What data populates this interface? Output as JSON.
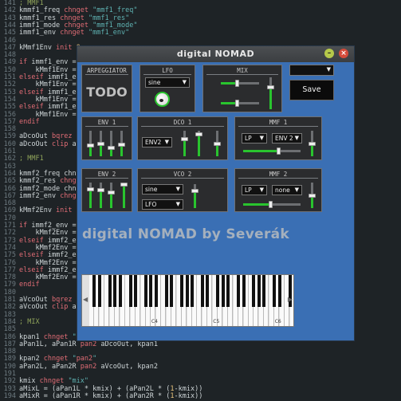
{
  "editor": {
    "lines": [
      {
        "n": "141",
        "code": "; MMF1"
      },
      {
        "n": "142",
        "code": "kmmf1_freq chnget \"mmf1_freq\""
      },
      {
        "n": "143",
        "code": "kmmf1_res chnget \"mmf1_res\""
      },
      {
        "n": "144",
        "code": "immf1_mode chnget \"mmf1_mode\""
      },
      {
        "n": "145",
        "code": "immf1_env chnget \"mmf1_env\""
      },
      {
        "n": "146",
        "code": ""
      },
      {
        "n": "147",
        "code": "kMmf1Env init 0"
      },
      {
        "n": "148",
        "code": ""
      },
      {
        "n": "149",
        "code": "if immf1_env =="
      },
      {
        "n": "150",
        "code": "    kMmf1Env ="
      },
      {
        "n": "151",
        "code": "elseif immf1_env"
      },
      {
        "n": "152",
        "code": "    kMmf1Env ="
      },
      {
        "n": "153",
        "code": "elseif immf1_env"
      },
      {
        "n": "154",
        "code": "    kMmf1Env ="
      },
      {
        "n": "155",
        "code": "elseif immf1_env"
      },
      {
        "n": "156",
        "code": "    kMmf1Env ="
      },
      {
        "n": "157",
        "code": "endif"
      },
      {
        "n": "158",
        "code": ""
      },
      {
        "n": "159",
        "code": "aDcoOut bqrez a"
      },
      {
        "n": "160",
        "code": "aDcoOut clip aD"
      },
      {
        "n": "161",
        "code": ""
      },
      {
        "n": "162",
        "code": "; MMF1"
      },
      {
        "n": "163",
        "code": ""
      },
      {
        "n": "164",
        "code": "kmmf2_freq chnge"
      },
      {
        "n": "165",
        "code": "kmmf2_res chnget"
      },
      {
        "n": "166",
        "code": "immf2_mode chng"
      },
      {
        "n": "167",
        "code": "immf2_env chnget"
      },
      {
        "n": "168",
        "code": ""
      },
      {
        "n": "169",
        "code": "kMmf2Env init 0"
      },
      {
        "n": "170",
        "code": ""
      },
      {
        "n": "171",
        "code": "if immf2_env =="
      },
      {
        "n": "172",
        "code": "    kMmf2Env ="
      },
      {
        "n": "173",
        "code": "elseif immf2_env"
      },
      {
        "n": "174",
        "code": "    kMmf2Env ="
      },
      {
        "n": "175",
        "code": "elseif immf2_env"
      },
      {
        "n": "176",
        "code": "    kMmf2Env ="
      },
      {
        "n": "177",
        "code": "elseif immf2_env"
      },
      {
        "n": "178",
        "code": "    kMmf2Env ="
      },
      {
        "n": "179",
        "code": "endif"
      },
      {
        "n": "180",
        "code": ""
      },
      {
        "n": "181",
        "code": "aVcoOut bqrez aV"
      },
      {
        "n": "182",
        "code": "aVcoOut clip aV"
      },
      {
        "n": "183",
        "code": ""
      },
      {
        "n": "184",
        "code": "; MIX"
      },
      {
        "n": "185",
        "code": ""
      },
      {
        "n": "186",
        "code": "kpan1 chnget \"pa"
      },
      {
        "n": "187",
        "code": "aPan1L, aPan1R pan2 aDcoOut, kpan1"
      },
      {
        "n": "188",
        "code": ""
      },
      {
        "n": "189",
        "code": "kpan2 chnget \"pan2\""
      },
      {
        "n": "190",
        "code": "aPan2L, aPan2R pan2 aVcoOut, kpan2"
      },
      {
        "n": "191",
        "code": ""
      },
      {
        "n": "192",
        "code": "kmix chnget \"mix\""
      },
      {
        "n": "193",
        "code": "aMixL = (aPan1L * kmix) + (aPan2L * (1-kmix))"
      },
      {
        "n": "194",
        "code": "aMixR = (aPan1R * kmix) + (aPan2R * (1-kmix))"
      }
    ]
  },
  "plugin": {
    "title": "digital NOMAD",
    "arpeggiator": {
      "title": "ARPEGGIATOR",
      "todo": "TODO"
    },
    "lfo": {
      "title": "LFO",
      "wave": "sine"
    },
    "mix": {
      "title": "MIX"
    },
    "preset": {
      "value": ""
    },
    "save_label": "Save",
    "env1": {
      "title": "ENV 1"
    },
    "dco1": {
      "title": "DCO 1",
      "mode": "ENV2"
    },
    "mmf1": {
      "title": "MMF 1",
      "mode": "LP",
      "env": "ENV 2"
    },
    "env2": {
      "title": "ENV 2"
    },
    "vco2": {
      "title": "VCO 2",
      "wave": "sine",
      "mod": "LFO"
    },
    "mmf2": {
      "title": "MMF 2",
      "mode": "LP",
      "env": "none"
    },
    "big_title": "digital NOMAD by Severák",
    "keyboard": {
      "labels": [
        "C4",
        "C5",
        "C6"
      ]
    }
  },
  "colors": {
    "accent_green": "#29c42e",
    "window_blue": "#3a6fb4",
    "panel_bg": "#2b2c2e"
  }
}
